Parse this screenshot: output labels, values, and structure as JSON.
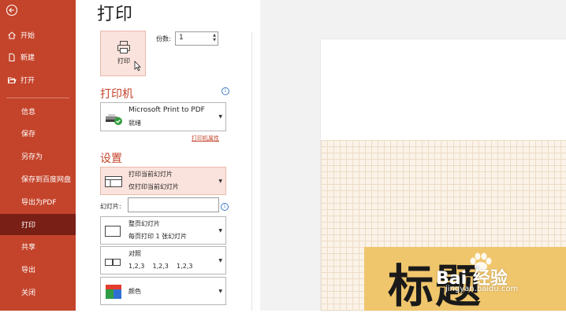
{
  "app": {
    "page_title": "打印",
    "accent_color": "#c4442b",
    "active_nav_color": "#7a1f16"
  },
  "sidebar": {
    "back_icon": "back-arrow-circle-icon",
    "items": [
      {
        "label": "开始",
        "icon": "home-icon"
      },
      {
        "label": "新建",
        "icon": "new-document-icon"
      },
      {
        "label": "打开",
        "icon": "open-folder-icon"
      },
      {
        "label": "信息"
      },
      {
        "label": "保存"
      },
      {
        "label": "另存为"
      },
      {
        "label": "保存到百度网盘"
      },
      {
        "label": "导出为PDF"
      },
      {
        "label": "打印",
        "active": true
      },
      {
        "label": "共享"
      },
      {
        "label": "导出"
      },
      {
        "label": "关闭"
      }
    ]
  },
  "print": {
    "button_label": "打印",
    "copies_label": "份数:",
    "copies_value": "1"
  },
  "printer": {
    "section_title": "打印机",
    "name": "Microsoft Print to PDF",
    "status": "就绪",
    "properties_link": "打印机属性"
  },
  "settings": {
    "section_title": "设置",
    "range": {
      "title": "打印当前幻灯片",
      "subtitle": "仅打印当前幻灯片"
    },
    "slides_label": "幻灯片:",
    "slides_value": "",
    "layout": {
      "title": "整页幻灯片",
      "subtitle": "每页打印 1 张幻灯片"
    },
    "collation": {
      "title": "对照",
      "subtitle": "1,2,3    1,2,3    1,2,3"
    },
    "color": {
      "title": "颜色"
    }
  },
  "preview": {
    "slide_title": "标题",
    "watermark_brand": "Bai 经验",
    "watermark_url": "jingyan.baidu.com"
  }
}
